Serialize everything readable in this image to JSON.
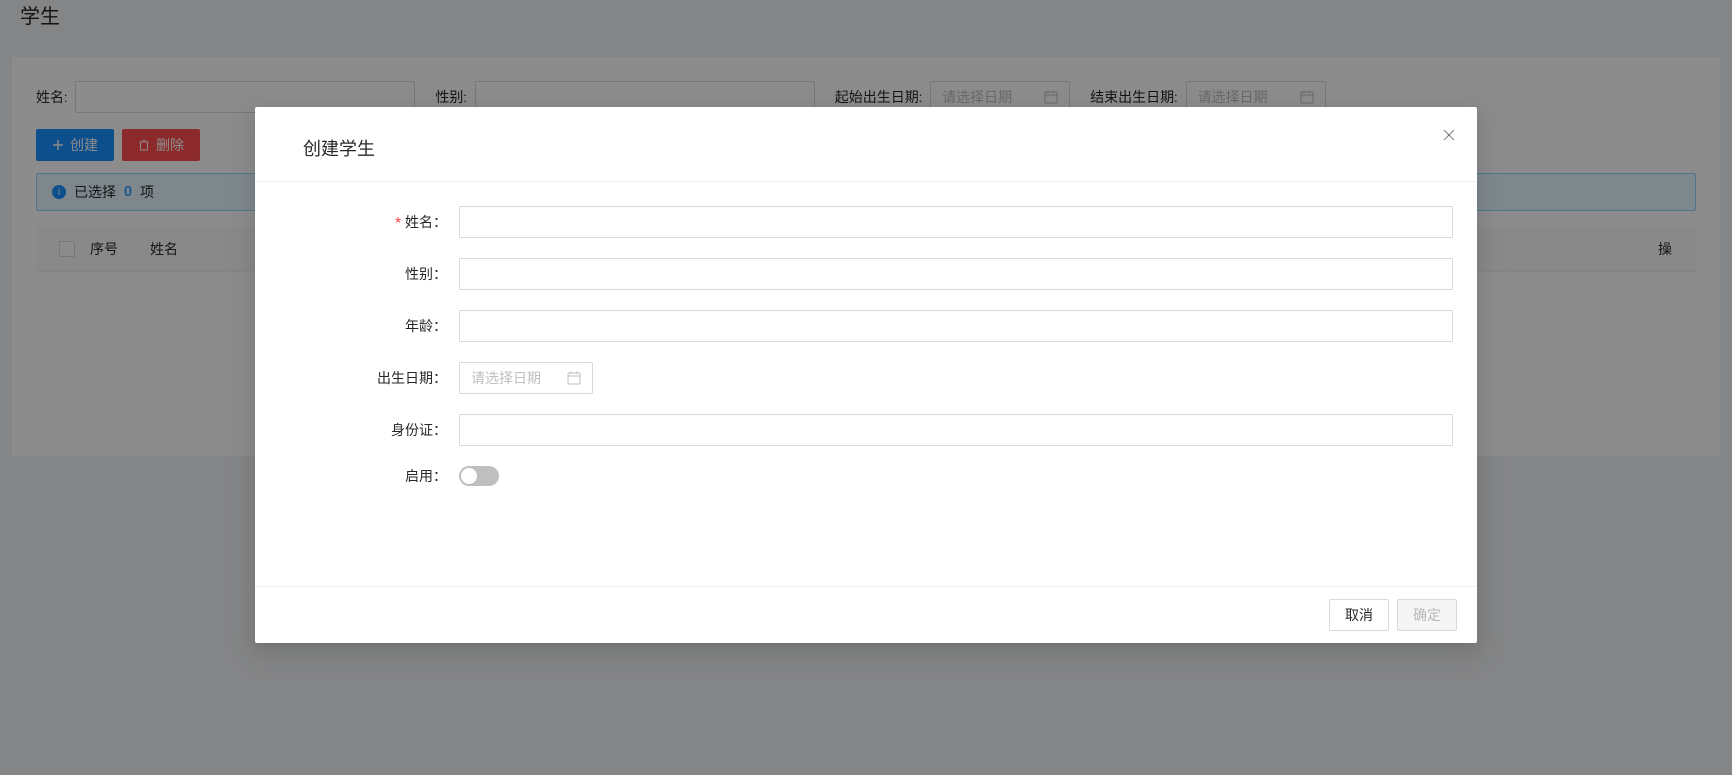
{
  "page": {
    "title": "学生"
  },
  "filters": {
    "name_label": "姓名:",
    "gender_label": "性别:",
    "start_birth_label": "起始出生日期:",
    "end_birth_label": "结束出生日期:",
    "date_placeholder": "请选择日期"
  },
  "actions": {
    "create": "创建",
    "delete": "删除"
  },
  "alert": {
    "prefix": "已选择",
    "count": "0",
    "suffix": "项"
  },
  "table": {
    "seq_header": "序号",
    "name_header": "姓名",
    "op_header": "操"
  },
  "modal": {
    "title": "创建学生",
    "labels": {
      "name": "姓名：",
      "gender": "性别：",
      "age": "年龄：",
      "birth": "出生日期：",
      "id": "身份证：",
      "enable": "启用："
    },
    "date_placeholder": "请选择日期",
    "cancel": "取消",
    "confirm": "确定"
  }
}
